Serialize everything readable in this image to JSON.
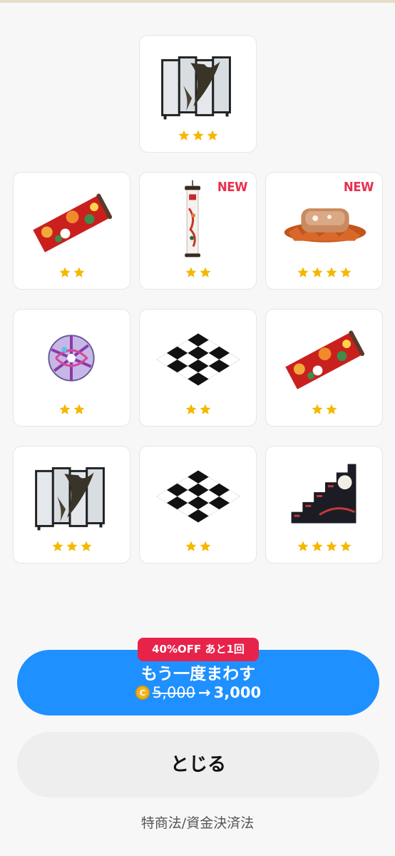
{
  "items": [
    {
      "name": "folding-screen",
      "stars": 3,
      "is_new": false
    },
    {
      "name": "floral-rug",
      "stars": 2,
      "is_new": false
    },
    {
      "name": "hanging-scroll",
      "stars": 2,
      "is_new": true
    },
    {
      "name": "autumn-leaf-sofa",
      "stars": 4,
      "is_new": true
    },
    {
      "name": "temari-ball",
      "stars": 2,
      "is_new": false
    },
    {
      "name": "checkered-floor",
      "stars": 2,
      "is_new": false
    },
    {
      "name": "floral-rug",
      "stars": 2,
      "is_new": false
    },
    {
      "name": "folding-screen",
      "stars": 3,
      "is_new": false
    },
    {
      "name": "checkered-floor",
      "stars": 2,
      "is_new": false
    },
    {
      "name": "step-chest",
      "stars": 4,
      "is_new": false
    }
  ],
  "new_label": "NEW",
  "respin": {
    "badge": "40%OFF あと1回",
    "label": "もう一度まわす",
    "coin_symbol": "C",
    "old_price": "5,000",
    "arrow": "→",
    "new_price": "3,000"
  },
  "close_label": "とじる",
  "legal_link": "特商法/資金決済法",
  "colors": {
    "primary": "#1e90ff",
    "badge": "#e8234a",
    "star": "#f5b800",
    "new": "#e8304f"
  }
}
